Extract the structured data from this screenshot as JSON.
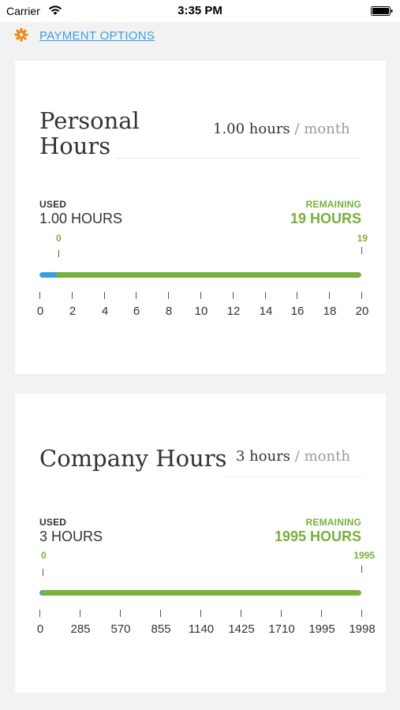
{
  "status_bar": {
    "carrier": "Carrier",
    "time": "3:35 PM"
  },
  "top_bar": {
    "icon": "gear-icon",
    "payment_link": "PAYMENT OPTIONS"
  },
  "colors": {
    "accent_blue": "#3a9fe0",
    "accent_green": "#7ab03c",
    "gear_orange": "#f08a1c"
  },
  "personal": {
    "title_line1": "Personal",
    "title_line2": "Hours",
    "rate_value": "1.00 hours",
    "rate_sep": "/",
    "rate_unit": "month",
    "used_label": "USED",
    "used_value": "1.00 HOURS",
    "remaining_label": "REMAINING",
    "remaining_value": "19 HOURS",
    "marker_start": "0",
    "marker_end": "19",
    "used_fraction": 0.05,
    "axis_ticks": [
      "0",
      "2",
      "4",
      "6",
      "8",
      "10",
      "12",
      "14",
      "16",
      "18",
      "20"
    ]
  },
  "company": {
    "title": "Company Hours",
    "rate_value": "3 hours",
    "rate_sep": "/",
    "rate_unit": "month",
    "used_label": "USED",
    "used_value": "3 HOURS",
    "remaining_label": "REMAINING",
    "remaining_value": "1995 HOURS",
    "marker_start": "0",
    "marker_end": "1995",
    "used_fraction": 0.0015,
    "axis_ticks": [
      "0",
      "285",
      "570",
      "855",
      "1140",
      "1425",
      "1710",
      "1995",
      "1998"
    ]
  }
}
